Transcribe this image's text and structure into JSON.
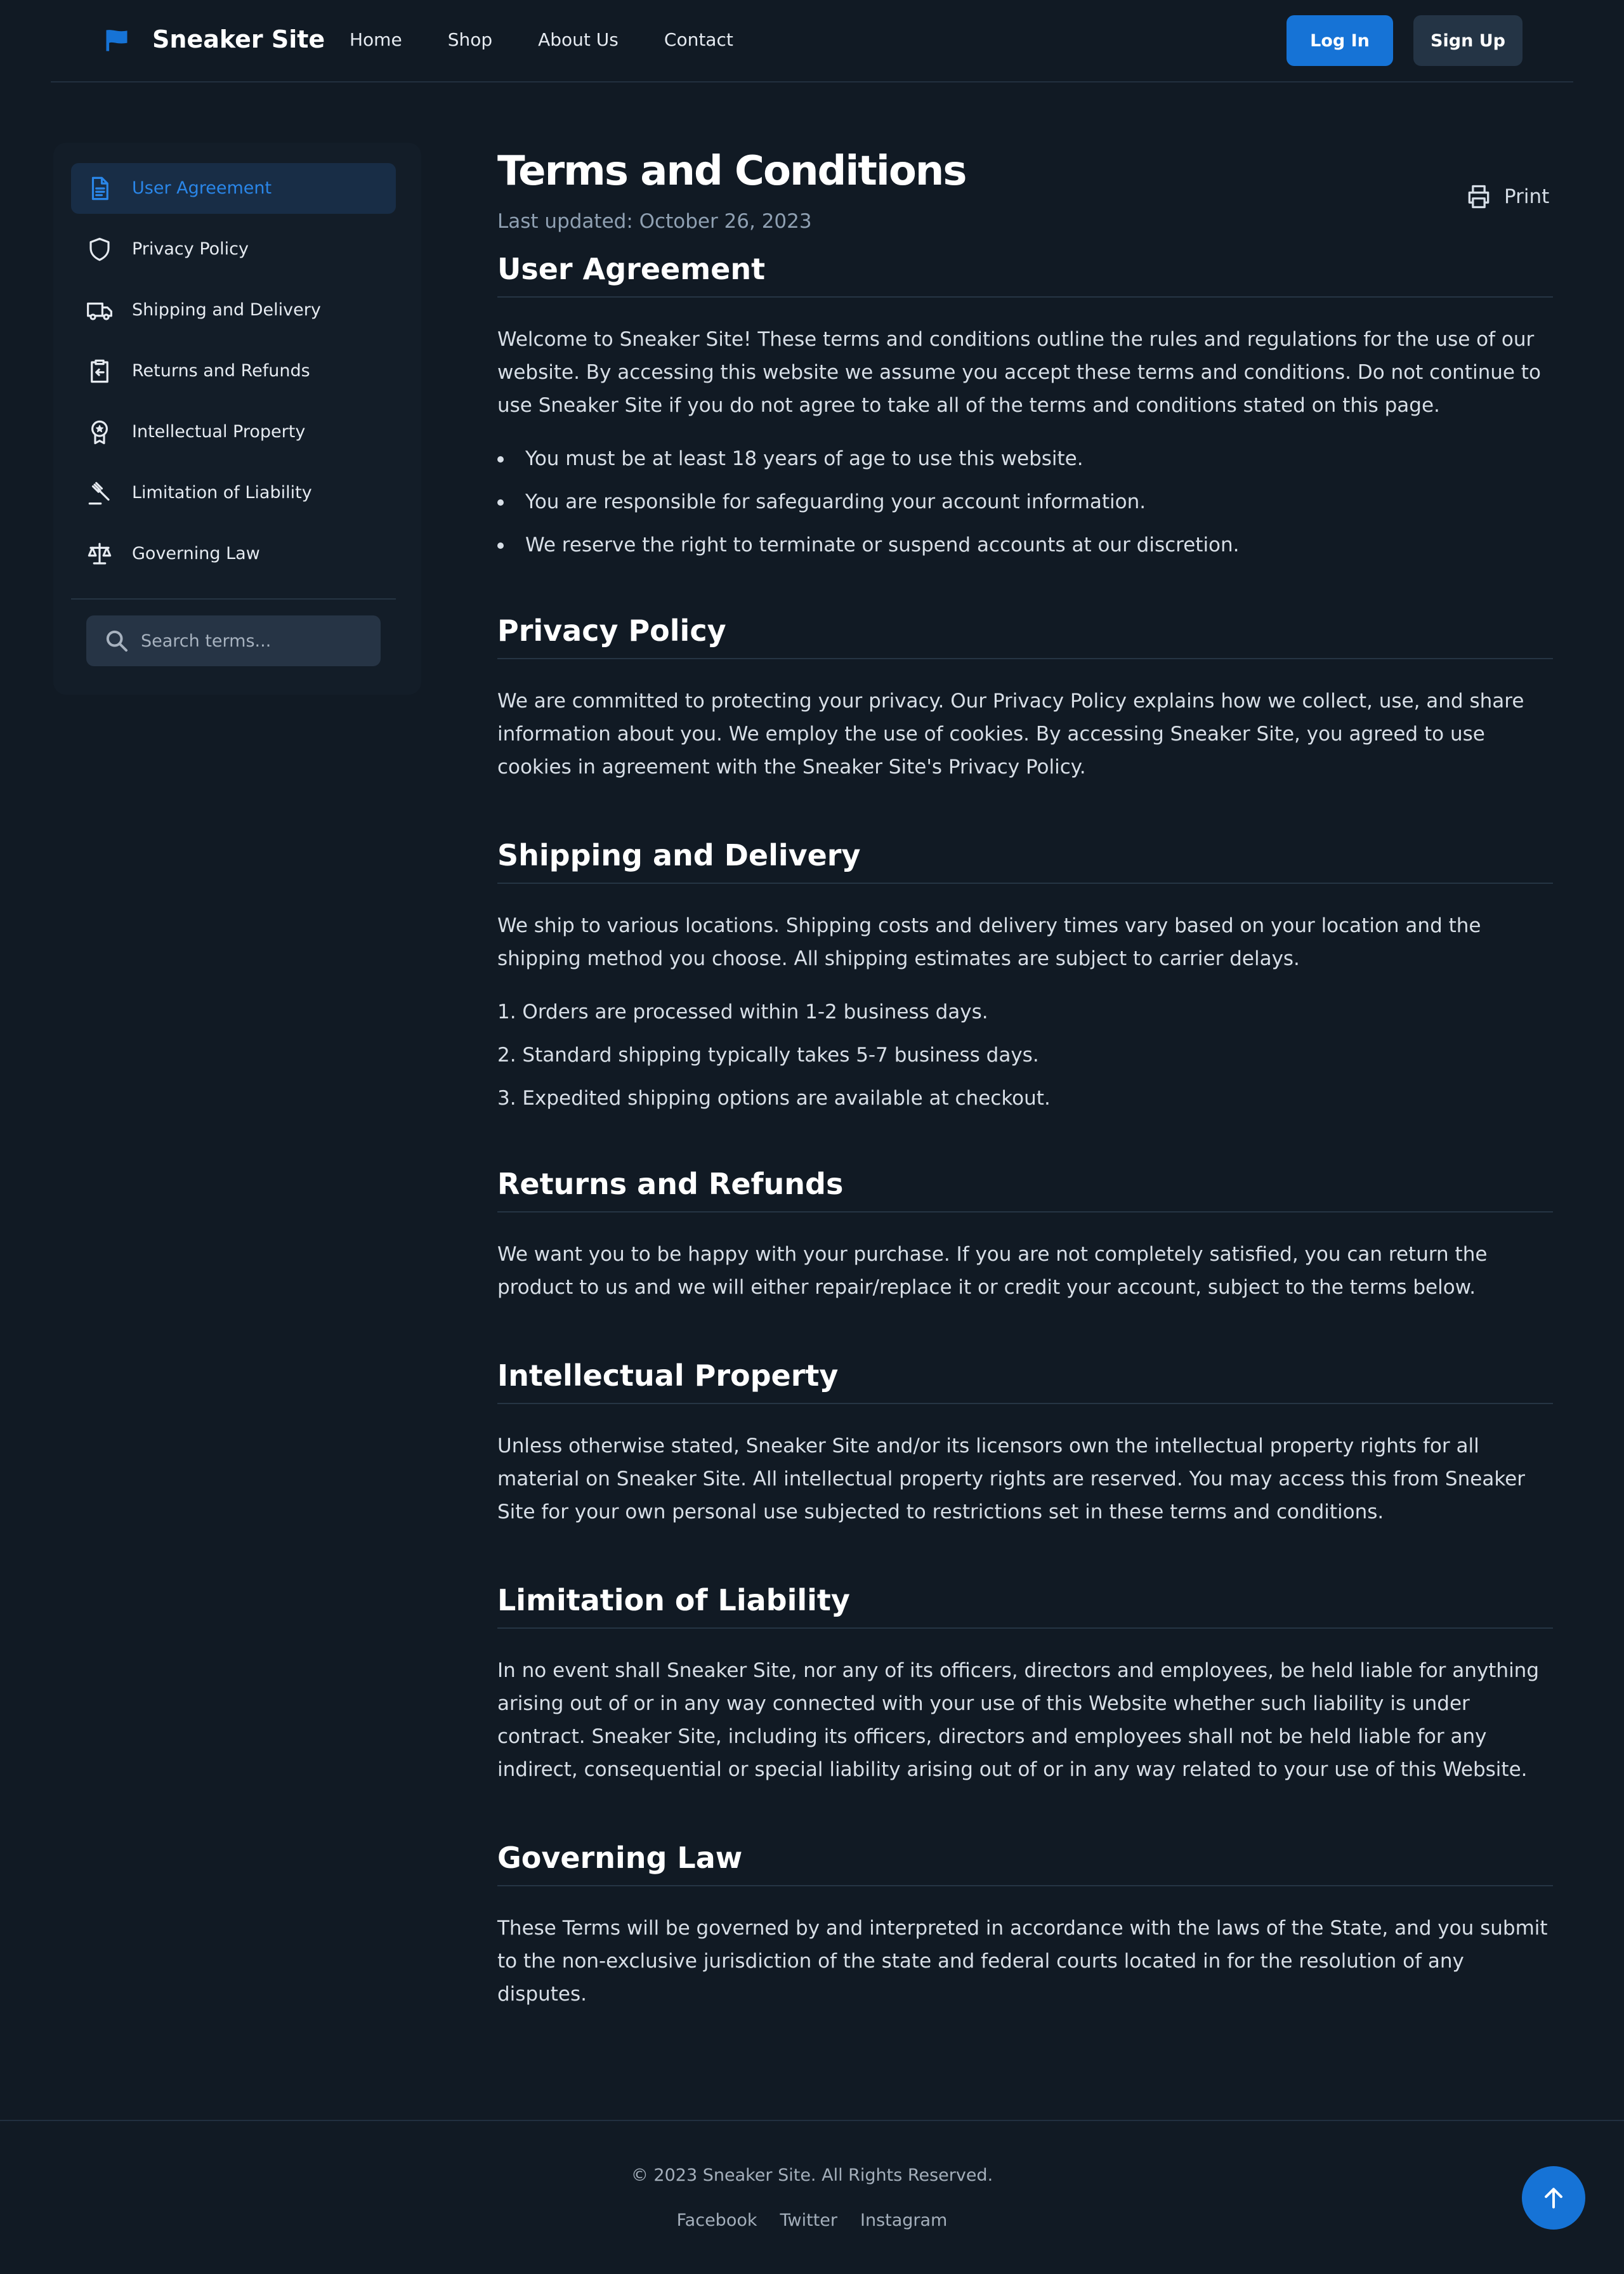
{
  "header": {
    "brand": "Sneaker Site",
    "nav": [
      "Home",
      "Shop",
      "About Us",
      "Contact"
    ],
    "login_label": "Log In",
    "signup_label": "Sign Up"
  },
  "sidebar": {
    "items": [
      {
        "label": "User Agreement",
        "icon": "document-icon",
        "active": true
      },
      {
        "label": "Privacy Policy",
        "icon": "shield-icon",
        "active": false
      },
      {
        "label": "Shipping and Delivery",
        "icon": "truck-icon",
        "active": false
      },
      {
        "label": "Returns and Refunds",
        "icon": "clipboard-return-icon",
        "active": false
      },
      {
        "label": "Intellectual Property",
        "icon": "badge-icon",
        "active": false
      },
      {
        "label": "Limitation of Liability",
        "icon": "gavel-icon",
        "active": false
      },
      {
        "label": "Governing Law",
        "icon": "scale-icon",
        "active": false
      }
    ],
    "search_placeholder": "Search terms..."
  },
  "main": {
    "title": "Terms and Conditions",
    "last_updated": "Last updated: October 26, 2023",
    "print_label": "Print",
    "sections": [
      {
        "heading": "User Agreement",
        "paragraph": "Welcome to Sneaker Site! These terms and conditions outline the rules and regulations for the use of our website. By accessing this website we assume you accept these terms and conditions. Do not continue to use Sneaker Site if you do not agree to take all of the terms and conditions stated on this page.",
        "bullets": [
          "You must be at least 18 years of age to use this website.",
          "You are responsible for safeguarding your account information.",
          "We reserve the right to terminate or suspend accounts at our discretion."
        ]
      },
      {
        "heading": "Privacy Policy",
        "paragraph": "We are committed to protecting your privacy. Our Privacy Policy explains how we collect, use, and share information about you. We employ the use of cookies. By accessing Sneaker Site, you agreed to use cookies in agreement with the Sneaker Site's Privacy Policy."
      },
      {
        "heading": "Shipping and Delivery",
        "paragraph": "We ship to various locations. Shipping costs and delivery times vary based on your location and the shipping method you choose. All shipping estimates are subject to carrier delays.",
        "numbered": [
          "1. Orders are processed within 1-2 business days.",
          "2. Standard shipping typically takes 5-7 business days.",
          "3. Expedited shipping options are available at checkout."
        ]
      },
      {
        "heading": "Returns and Refunds",
        "paragraph": "We want you to be happy with your purchase. If you are not completely satisfied, you can return the product to us and we will either repair/replace it or credit your account, subject to the terms below."
      },
      {
        "heading": "Intellectual Property",
        "paragraph": "Unless otherwise stated, Sneaker Site and/or its licensors own the intellectual property rights for all material on Sneaker Site. All intellectual property rights are reserved. You may access this from Sneaker Site for your own personal use subjected to restrictions set in these terms and conditions."
      },
      {
        "heading": "Limitation of Liability",
        "paragraph": "In no event shall Sneaker Site, nor any of its officers, directors and employees, be held liable for anything arising out of or in any way connected with your use of this Website whether such liability is under contract. Sneaker Site, including its officers, directors and employees shall not be held liable for any indirect, consequential or special liability arising out of or in any way related to your use of this Website."
      },
      {
        "heading": "Governing Law",
        "paragraph": "These Terms will be governed by and interpreted in accordance with the laws of the State, and you submit to the non-exclusive jurisdiction of the state and federal courts located in for the resolution of any disputes."
      }
    ]
  },
  "footer": {
    "copyright": "© 2023 Sneaker Site. All Rights Reserved.",
    "links": [
      "Facebook",
      "Twitter",
      "Instagram"
    ]
  },
  "colors": {
    "background": "#111a24",
    "accent": "#1673d6",
    "active_nav_bg": "#182d46",
    "active_nav_text": "#2a86e8"
  },
  "icons": {
    "logo": "flag-icon",
    "print": "printer-icon",
    "search": "search-icon",
    "to_top": "arrow-up-icon"
  }
}
